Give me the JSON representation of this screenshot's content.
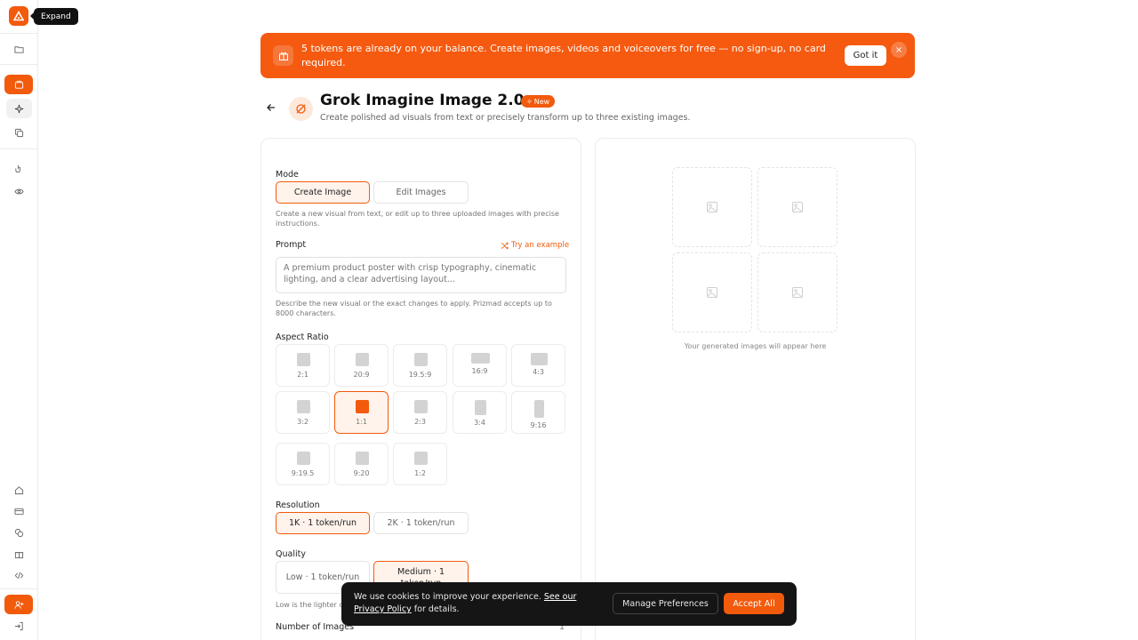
{
  "sidebar": {
    "tooltip": "Expand"
  },
  "banner": {
    "text": "5 tokens are already on your balance. Create images, videos and voiceovers for free — no sign-up, no card required.",
    "got_it": "Got it",
    "close": "×"
  },
  "header": {
    "title": "Grok Imagine Image 2.0",
    "badge": "New",
    "subtitle": "Create polished ad visuals from text or precisely transform up to three existing images."
  },
  "mode": {
    "label": "Mode",
    "options": [
      "Create Image",
      "Edit Images"
    ],
    "selected": "Create Image",
    "hint": "Create a new visual from text, or edit up to three uploaded images with precise instructions."
  },
  "prompt": {
    "label": "Prompt",
    "try_example": "Try an example",
    "placeholder": "A premium product poster with crisp typography, cinematic lighting, and a clear advertising layout...",
    "hint": "Describe the new visual or the exact changes to apply. Prizmad accepts up to 8000 characters."
  },
  "aspect_ratio": {
    "label": "Aspect Ratio",
    "options": [
      "2:1",
      "20:9",
      "19.5:9",
      "16:9",
      "4:3",
      "3:2",
      "1:1",
      "2:3",
      "3:4",
      "9:16",
      "9:19.5",
      "9:20",
      "1:2"
    ],
    "selected": "1:1"
  },
  "resolution": {
    "label": "Resolution",
    "options": [
      "1K · 1 token/run",
      "2K · 1 token/run"
    ],
    "selected": "1K · 1 token/run"
  },
  "quality": {
    "label": "Quality",
    "options": [
      "Low · 1 token/run",
      "Medium · 1 token/run"
    ],
    "selected": "Medium · 1 token/run",
    "hint": "Low is the lighter option"
  },
  "num_images": {
    "label": "Number of Images",
    "value": "1"
  },
  "output": {
    "caption": "Your generated images will appear here"
  },
  "cookie": {
    "text_before": "We use cookies to improve your experience.",
    "link": "See our Privacy Policy",
    "text_after": "for details.",
    "manage": "Manage Preferences",
    "accept": "Accept All"
  },
  "colors": {
    "accent": "#f25a0c",
    "banner": "#f55a10"
  }
}
